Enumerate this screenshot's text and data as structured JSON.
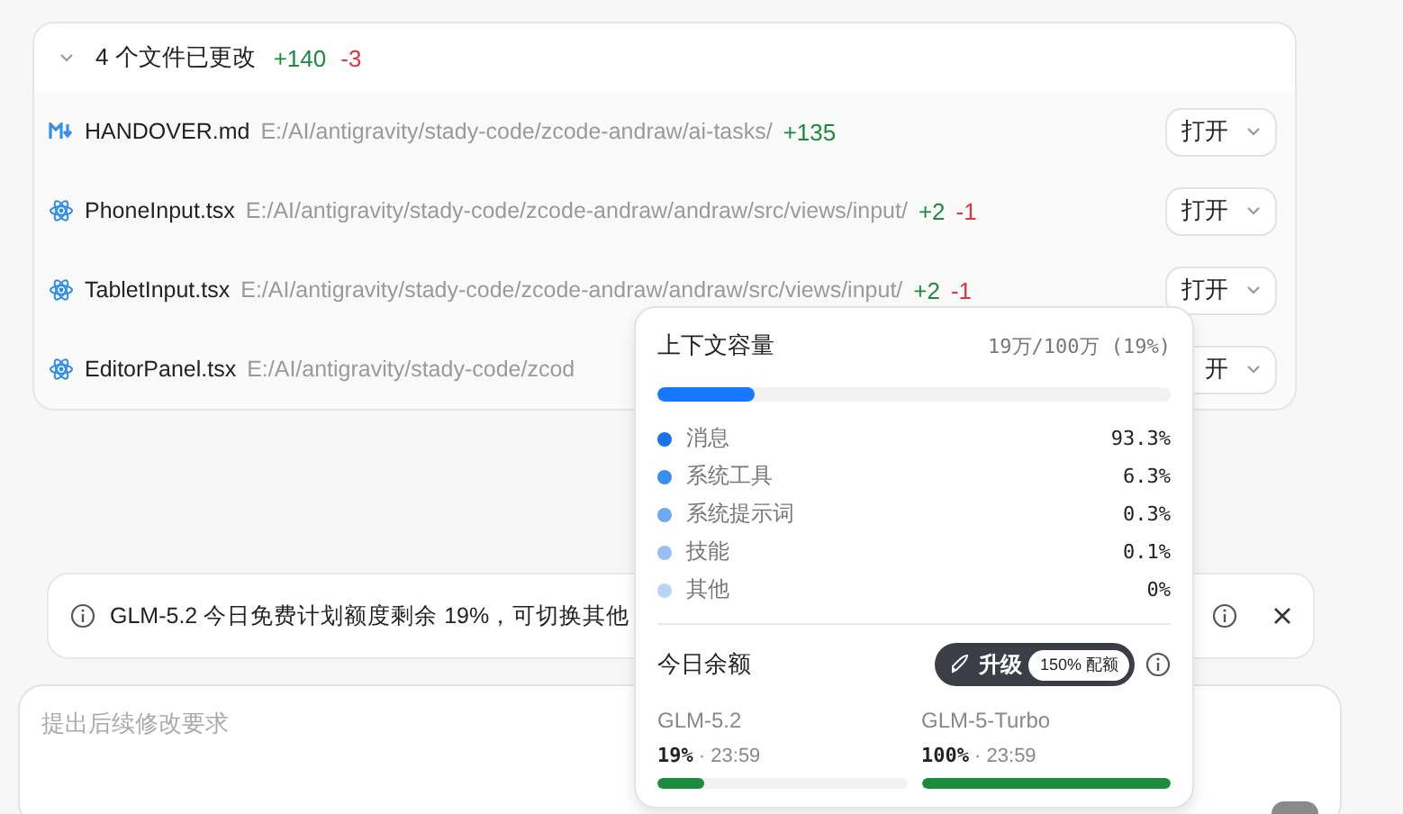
{
  "changes": {
    "title": "4 个文件已更改",
    "added": "+140",
    "removed": "-3",
    "expanded": true,
    "files": [
      {
        "kind": "markdown",
        "name": "HANDOVER.md",
        "path": "E:/AI/antigravity/stady-code/zcode-andraw/ai-tasks/",
        "added": "+135",
        "open": "打开"
      },
      {
        "kind": "react",
        "name": "PhoneInput.tsx",
        "path": "E:/AI/antigravity/stady-code/zcode-andraw/andraw/src/views/input/",
        "added": "+2",
        "removed": "-1",
        "open": "打开"
      },
      {
        "kind": "react",
        "name": "TabletInput.tsx",
        "path": "E:/AI/antigravity/stady-code/zcode-andraw/andraw/src/views/input/",
        "added": "+2",
        "removed": "-1",
        "open": "打开"
      },
      {
        "kind": "react",
        "name": "EditorPanel.tsx",
        "path": "E:/AI/antigravity/stady-code/zcod",
        "open": "开"
      }
    ]
  },
  "notice": {
    "text": "GLM-5.2 今日免费计划额度剩余 19%，可切换其他"
  },
  "composer": {
    "placeholder": "提出后续修改要求"
  },
  "context_popup": {
    "title": "上下文容量",
    "usage": "19万/100万 (19%)",
    "level": 0.19,
    "breakdown": [
      {
        "label": "消息",
        "value": "93.3%",
        "color": "#1a73e8"
      },
      {
        "label": "系统工具",
        "value": "6.3%",
        "color": "#3d8cf0"
      },
      {
        "label": "系统提示词",
        "value": "0.3%",
        "color": "#6ea9ee"
      },
      {
        "label": "技能",
        "value": "0.1%",
        "color": "#97c0f0"
      },
      {
        "label": "其他",
        "value": "0%",
        "color": "#b9d4f5"
      }
    ],
    "quota_title": "今日余额",
    "upgrade": "升级",
    "upgrade_badge": "150% 配额",
    "quotas": [
      {
        "model": "GLM-5.2",
        "percent": "19%",
        "reset": " · 23:59",
        "level": 0.19
      },
      {
        "model": "GLM-5-Turbo",
        "percent": "100%",
        "reset": " · 23:59",
        "level": 1
      }
    ]
  }
}
